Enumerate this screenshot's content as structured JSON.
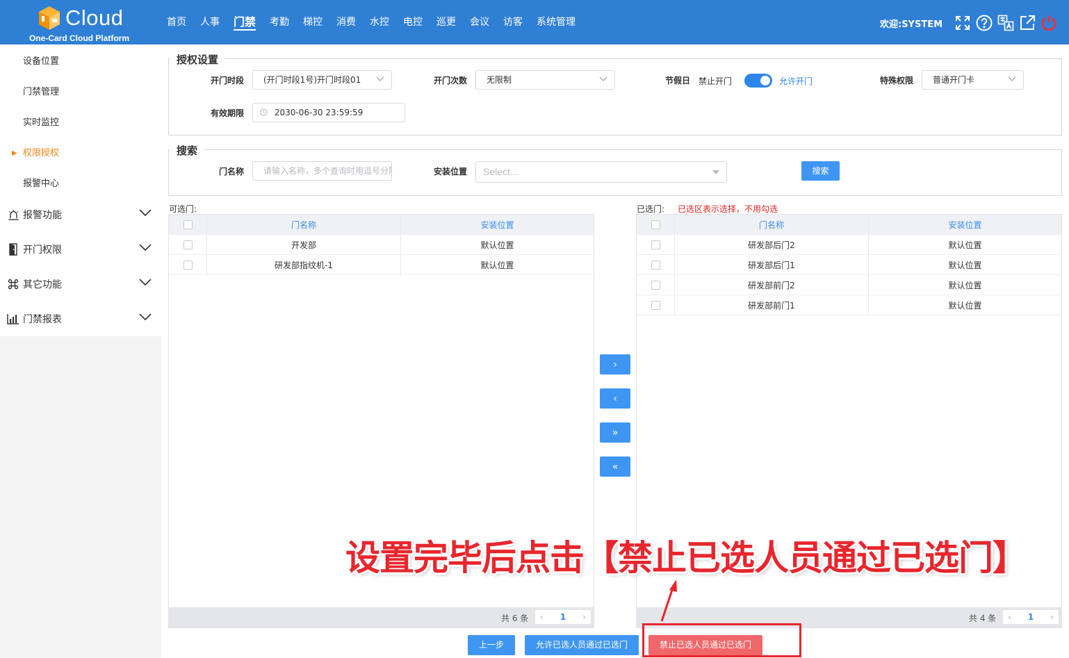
{
  "header": {
    "brand": "Cloud",
    "subtitle": "One-Card Cloud Platform",
    "nav": [
      "首页",
      "人事",
      "门禁",
      "考勤",
      "梯控",
      "消费",
      "水控",
      "电控",
      "巡更",
      "会议",
      "访客",
      "系统管理"
    ],
    "active_nav": "门禁",
    "welcome": "欢迎:SYSTEM",
    "icons": [
      "fullscreen-icon",
      "help-icon",
      "language-icon",
      "open-external-icon",
      "power-icon"
    ]
  },
  "sidebar": {
    "sub_items": [
      "设备位置",
      "门禁管理",
      "实时监控",
      "权限授权",
      "报警中心"
    ],
    "active_item": "权限授权",
    "groups": [
      {
        "label": "报警功能",
        "icon": "alarm-icon"
      },
      {
        "label": "开门权限",
        "icon": "door-icon"
      },
      {
        "label": "其它功能",
        "icon": "command-icon"
      },
      {
        "label": "门禁报表",
        "icon": "report-chart-icon"
      }
    ]
  },
  "auth": {
    "legend": "授权设置",
    "period_label": "开门时段",
    "period_value": "(开门时段1号)开门时段01",
    "count_label": "开门次数",
    "count_value": "无限制",
    "holiday_label": "节假日",
    "holiday_off": "禁止开门",
    "holiday_on": "允许开门",
    "special_label": "特殊权限",
    "special_value": "普通开门卡",
    "expiry_label": "有效期限",
    "expiry_value": "2030-06-30 23:59:59"
  },
  "search": {
    "legend": "搜索",
    "door_label": "门名称",
    "door_placeholder": "请输入名称，多个查询时用逗号分隔",
    "location_label": "安装位置",
    "location_placeholder": "Select...",
    "button": "搜索"
  },
  "available": {
    "caption": "可选门:",
    "headers": [
      "门名称",
      "安装位置"
    ],
    "rows": [
      {
        "name": "开发部",
        "location": "默认位置"
      },
      {
        "name": "研发部指纹机-1",
        "location": "默认位置"
      }
    ],
    "total": "共 6 条",
    "page": "1"
  },
  "selected": {
    "caption": "已选门:",
    "note": "已选区表示选择，不用勾选",
    "headers": [
      "门名称",
      "安装位置"
    ],
    "rows": [
      {
        "name": "研发部后门2",
        "location": "默认位置"
      },
      {
        "name": "研发部后门1",
        "location": "默认位置"
      },
      {
        "name": "研发部前门2",
        "location": "默认位置"
      },
      {
        "name": "研发部前门1",
        "location": "默认位置"
      }
    ],
    "total": "共 4 条",
    "page": "1"
  },
  "transfer": {
    "move_right": "›",
    "move_left": "‹",
    "move_all_right": "»",
    "move_all_left": "«"
  },
  "footer": {
    "prev": "上一步",
    "allow": "允许已选人员通过已选门",
    "deny": "禁止已选人员通过已选门"
  },
  "annotation": {
    "text": "设置完毕后点击【禁止已选人员通过已选门】",
    "color": "#e8262d"
  },
  "colors": {
    "header": "#2f7fd5",
    "primary": "#3f96f2",
    "active_sidebar": "#f08a1a",
    "danger_button": "#f0676a",
    "note": "#e02424"
  }
}
